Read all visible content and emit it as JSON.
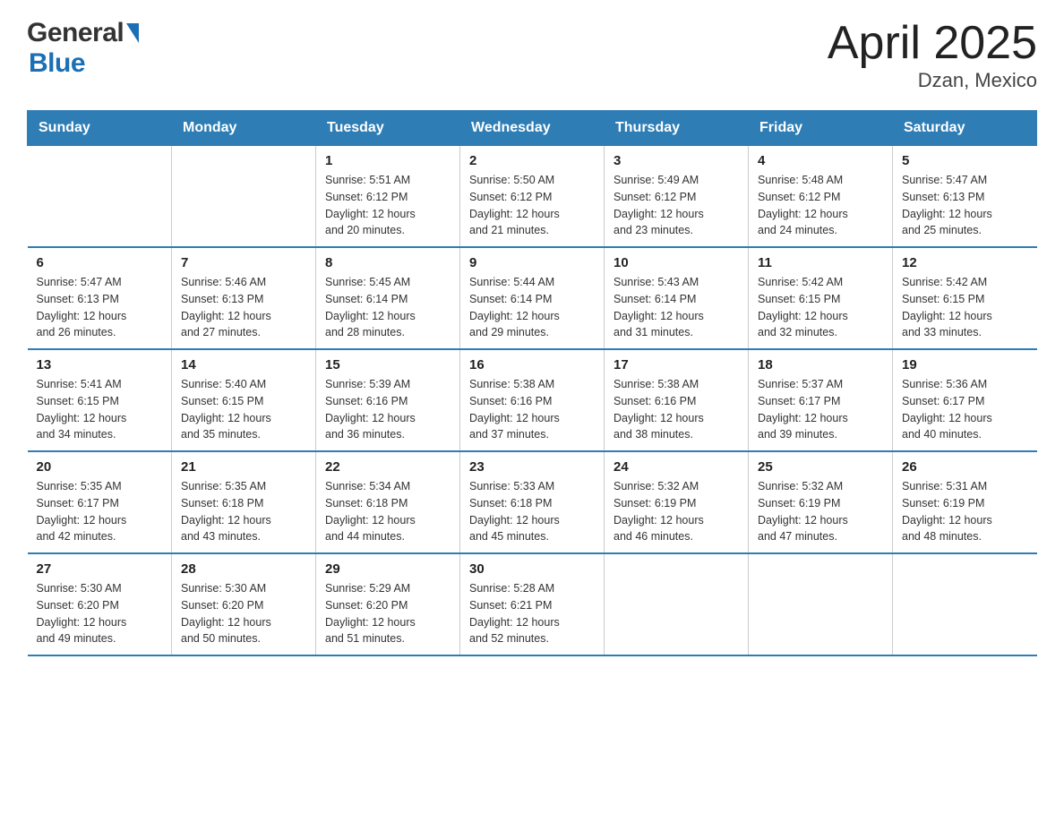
{
  "header": {
    "logo_general": "General",
    "logo_blue": "Blue",
    "title": "April 2025",
    "location": "Dzan, Mexico"
  },
  "calendar": {
    "days_of_week": [
      "Sunday",
      "Monday",
      "Tuesday",
      "Wednesday",
      "Thursday",
      "Friday",
      "Saturday"
    ],
    "weeks": [
      [
        {
          "day": "",
          "info": ""
        },
        {
          "day": "",
          "info": ""
        },
        {
          "day": "1",
          "info": "Sunrise: 5:51 AM\nSunset: 6:12 PM\nDaylight: 12 hours\nand 20 minutes."
        },
        {
          "day": "2",
          "info": "Sunrise: 5:50 AM\nSunset: 6:12 PM\nDaylight: 12 hours\nand 21 minutes."
        },
        {
          "day": "3",
          "info": "Sunrise: 5:49 AM\nSunset: 6:12 PM\nDaylight: 12 hours\nand 23 minutes."
        },
        {
          "day": "4",
          "info": "Sunrise: 5:48 AM\nSunset: 6:12 PM\nDaylight: 12 hours\nand 24 minutes."
        },
        {
          "day": "5",
          "info": "Sunrise: 5:47 AM\nSunset: 6:13 PM\nDaylight: 12 hours\nand 25 minutes."
        }
      ],
      [
        {
          "day": "6",
          "info": "Sunrise: 5:47 AM\nSunset: 6:13 PM\nDaylight: 12 hours\nand 26 minutes."
        },
        {
          "day": "7",
          "info": "Sunrise: 5:46 AM\nSunset: 6:13 PM\nDaylight: 12 hours\nand 27 minutes."
        },
        {
          "day": "8",
          "info": "Sunrise: 5:45 AM\nSunset: 6:14 PM\nDaylight: 12 hours\nand 28 minutes."
        },
        {
          "day": "9",
          "info": "Sunrise: 5:44 AM\nSunset: 6:14 PM\nDaylight: 12 hours\nand 29 minutes."
        },
        {
          "day": "10",
          "info": "Sunrise: 5:43 AM\nSunset: 6:14 PM\nDaylight: 12 hours\nand 31 minutes."
        },
        {
          "day": "11",
          "info": "Sunrise: 5:42 AM\nSunset: 6:15 PM\nDaylight: 12 hours\nand 32 minutes."
        },
        {
          "day": "12",
          "info": "Sunrise: 5:42 AM\nSunset: 6:15 PM\nDaylight: 12 hours\nand 33 minutes."
        }
      ],
      [
        {
          "day": "13",
          "info": "Sunrise: 5:41 AM\nSunset: 6:15 PM\nDaylight: 12 hours\nand 34 minutes."
        },
        {
          "day": "14",
          "info": "Sunrise: 5:40 AM\nSunset: 6:15 PM\nDaylight: 12 hours\nand 35 minutes."
        },
        {
          "day": "15",
          "info": "Sunrise: 5:39 AM\nSunset: 6:16 PM\nDaylight: 12 hours\nand 36 minutes."
        },
        {
          "day": "16",
          "info": "Sunrise: 5:38 AM\nSunset: 6:16 PM\nDaylight: 12 hours\nand 37 minutes."
        },
        {
          "day": "17",
          "info": "Sunrise: 5:38 AM\nSunset: 6:16 PM\nDaylight: 12 hours\nand 38 minutes."
        },
        {
          "day": "18",
          "info": "Sunrise: 5:37 AM\nSunset: 6:17 PM\nDaylight: 12 hours\nand 39 minutes."
        },
        {
          "day": "19",
          "info": "Sunrise: 5:36 AM\nSunset: 6:17 PM\nDaylight: 12 hours\nand 40 minutes."
        }
      ],
      [
        {
          "day": "20",
          "info": "Sunrise: 5:35 AM\nSunset: 6:17 PM\nDaylight: 12 hours\nand 42 minutes."
        },
        {
          "day": "21",
          "info": "Sunrise: 5:35 AM\nSunset: 6:18 PM\nDaylight: 12 hours\nand 43 minutes."
        },
        {
          "day": "22",
          "info": "Sunrise: 5:34 AM\nSunset: 6:18 PM\nDaylight: 12 hours\nand 44 minutes."
        },
        {
          "day": "23",
          "info": "Sunrise: 5:33 AM\nSunset: 6:18 PM\nDaylight: 12 hours\nand 45 minutes."
        },
        {
          "day": "24",
          "info": "Sunrise: 5:32 AM\nSunset: 6:19 PM\nDaylight: 12 hours\nand 46 minutes."
        },
        {
          "day": "25",
          "info": "Sunrise: 5:32 AM\nSunset: 6:19 PM\nDaylight: 12 hours\nand 47 minutes."
        },
        {
          "day": "26",
          "info": "Sunrise: 5:31 AM\nSunset: 6:19 PM\nDaylight: 12 hours\nand 48 minutes."
        }
      ],
      [
        {
          "day": "27",
          "info": "Sunrise: 5:30 AM\nSunset: 6:20 PM\nDaylight: 12 hours\nand 49 minutes."
        },
        {
          "day": "28",
          "info": "Sunrise: 5:30 AM\nSunset: 6:20 PM\nDaylight: 12 hours\nand 50 minutes."
        },
        {
          "day": "29",
          "info": "Sunrise: 5:29 AM\nSunset: 6:20 PM\nDaylight: 12 hours\nand 51 minutes."
        },
        {
          "day": "30",
          "info": "Sunrise: 5:28 AM\nSunset: 6:21 PM\nDaylight: 12 hours\nand 52 minutes."
        },
        {
          "day": "",
          "info": ""
        },
        {
          "day": "",
          "info": ""
        },
        {
          "day": "",
          "info": ""
        }
      ]
    ]
  }
}
